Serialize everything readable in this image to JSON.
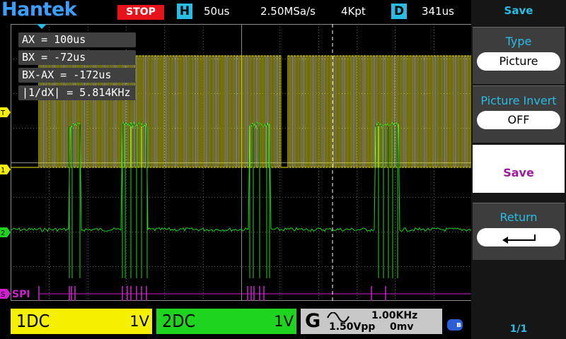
{
  "header": {
    "brand": "Hantek",
    "run_state": "STOP",
    "h_label": "H",
    "timebase": "50us",
    "sample_rate": "2.50MSa/s",
    "memory_depth": "4Kpt",
    "d_label": "D",
    "delay": "341us"
  },
  "markers": {
    "trigger": "T",
    "ch1": "1",
    "ch2": "2",
    "spi": "S"
  },
  "cursor_readout": {
    "ax": "AX    = 100us",
    "bx": "BX    = -72us",
    "diff": "BX-AX = -172us",
    "freq": "|1/dX|  = 5.814KHz"
  },
  "decode": {
    "label": "SPI"
  },
  "channels": {
    "ch1": {
      "name": "1DC",
      "scale": "1V",
      "color": "#f5f000"
    },
    "ch2": {
      "name": "2DC",
      "scale": "1V",
      "color": "#1fd41f"
    }
  },
  "generator": {
    "letter": "G",
    "frequency": "1.00KHz",
    "amplitude": "1.50Vpp",
    "offset": "0mv"
  },
  "bluetooth": {
    "glyph": "ʙ"
  },
  "menu": {
    "title": "Save",
    "type_label": "Type",
    "type_value": "Picture",
    "invert_label": "Picture Invert",
    "invert_value": "OFF",
    "save_label": "Save",
    "return_label": "Return",
    "page": "1/1"
  }
}
